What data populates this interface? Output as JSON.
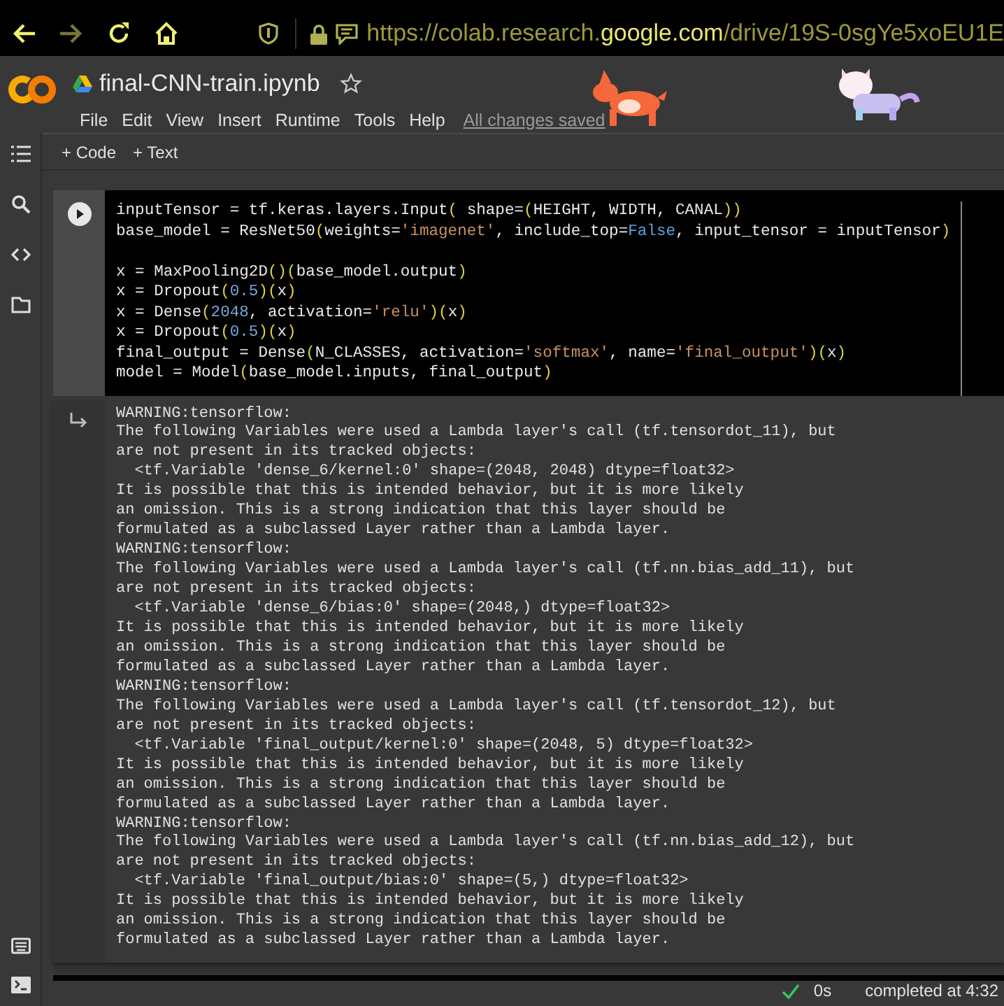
{
  "browser": {
    "nav": [
      {
        "kind": "back",
        "disabled": false
      },
      {
        "kind": "forward",
        "disabled": true
      },
      {
        "kind": "reload",
        "disabled": false
      },
      {
        "kind": "home",
        "disabled": false
      }
    ],
    "url": {
      "prefix": "https://colab.research.",
      "domain": "google.com",
      "path": "/drive/19S-0sgYe5xoEU1E"
    }
  },
  "header": {
    "title": "final-CNN-train.ipynb",
    "starred": false,
    "menu": [
      "File",
      "Edit",
      "View",
      "Insert",
      "Runtime",
      "Tools",
      "Help"
    ],
    "save_status": "All changes saved"
  },
  "toolbar": {
    "buttons": [
      {
        "icon": "+",
        "label": "Code"
      },
      {
        "icon": "+",
        "label": "Text"
      }
    ]
  },
  "sidebar": {
    "top": [
      {
        "kind": "toc"
      },
      {
        "kind": "search"
      },
      {
        "kind": "code"
      },
      {
        "kind": "folder"
      }
    ],
    "bottom": [
      {
        "kind": "palette"
      },
      {
        "kind": "terminal"
      }
    ]
  },
  "cell": {
    "code": [
      {
        "tokens": [
          {
            "text": "inputTensor = tf.keras.layers.Input",
            "kind": "plain"
          },
          {
            "text": "(",
            "kind": "bracket"
          },
          {
            "text": " shape=",
            "kind": "plain"
          },
          {
            "text": "(",
            "kind": "bracket"
          },
          {
            "text": "HEIGHT, WIDTH, CANAL",
            "kind": "plain"
          },
          {
            "text": "))",
            "kind": "bracket"
          }
        ]
      },
      {
        "tokens": [
          {
            "text": "base_model = ResNet50",
            "kind": "plain"
          },
          {
            "text": "(",
            "kind": "bracket"
          },
          {
            "text": "weights=",
            "kind": "plain"
          },
          {
            "text": "'imagenet'",
            "kind": "string"
          },
          {
            "text": ", include_top=",
            "kind": "plain"
          },
          {
            "text": "False",
            "kind": "keyword"
          },
          {
            "text": ", input_tensor = inputTensor",
            "kind": "plain"
          },
          {
            "text": ")",
            "kind": "bracket"
          }
        ]
      },
      {
        "gap_before": true,
        "tokens": [
          {
            "text": "x = MaxPooling2D",
            "kind": "plain"
          },
          {
            "text": "()(",
            "kind": "bracket"
          },
          {
            "text": "base_model.output",
            "kind": "plain"
          },
          {
            "text": ")",
            "kind": "bracket"
          }
        ]
      },
      {
        "tokens": [
          {
            "text": "x = Dropout",
            "kind": "plain"
          },
          {
            "text": "(",
            "kind": "bracket"
          },
          {
            "text": "0.5",
            "kind": "number"
          },
          {
            "text": ")(",
            "kind": "bracket"
          },
          {
            "text": "x",
            "kind": "plain"
          },
          {
            "text": ")",
            "kind": "bracket"
          }
        ]
      },
      {
        "tokens": [
          {
            "text": "x = Dense",
            "kind": "plain"
          },
          {
            "text": "(",
            "kind": "bracket"
          },
          {
            "text": "2048",
            "kind": "number"
          },
          {
            "text": ", activation=",
            "kind": "plain"
          },
          {
            "text": "'relu'",
            "kind": "string"
          },
          {
            "text": ")(",
            "kind": "bracket"
          },
          {
            "text": "x",
            "kind": "plain"
          },
          {
            "text": ")",
            "kind": "bracket"
          }
        ]
      },
      {
        "tokens": [
          {
            "text": "x = Dropout",
            "kind": "plain"
          },
          {
            "text": "(",
            "kind": "bracket"
          },
          {
            "text": "0.5",
            "kind": "number"
          },
          {
            "text": ")(",
            "kind": "bracket"
          },
          {
            "text": "x",
            "kind": "plain"
          },
          {
            "text": ")",
            "kind": "bracket"
          }
        ]
      },
      {
        "tokens": [
          {
            "text": "final_output = Dense",
            "kind": "plain"
          },
          {
            "text": "(",
            "kind": "bracket"
          },
          {
            "text": "N_CLASSES, activation=",
            "kind": "plain"
          },
          {
            "text": "'softmax'",
            "kind": "string"
          },
          {
            "text": ", name=",
            "kind": "plain"
          },
          {
            "text": "'final_output'",
            "kind": "string"
          },
          {
            "text": ")(",
            "kind": "bracket"
          },
          {
            "text": "x",
            "kind": "plain"
          },
          {
            "text": ")",
            "kind": "bracket"
          }
        ]
      },
      {
        "tokens": [
          {
            "text": "model = Model",
            "kind": "plain"
          },
          {
            "text": "(",
            "kind": "bracket"
          },
          {
            "text": "base_model.inputs, final_output",
            "kind": "plain"
          },
          {
            "text": ")",
            "kind": "bracket"
          }
        ]
      }
    ],
    "output": [
      "WARNING:tensorflow:",
      "The following Variables were used a Lambda layer's call (tf.tensordot_11), but",
      "are not present in its tracked objects:",
      "  <tf.Variable 'dense_6/kernel:0' shape=(2048, 2048) dtype=float32>",
      "It is possible that this is intended behavior, but it is more likely",
      "an omission. This is a strong indication that this layer should be",
      "formulated as a subclassed Layer rather than a Lambda layer.",
      "WARNING:tensorflow:",
      "The following Variables were used a Lambda layer's call (tf.nn.bias_add_11), but",
      "are not present in its tracked objects:",
      "  <tf.Variable 'dense_6/bias:0' shape=(2048,) dtype=float32>",
      "It is possible that this is intended behavior, but it is more likely",
      "an omission. This is a strong indication that this layer should be",
      "formulated as a subclassed Layer rather than a Lambda layer.",
      "WARNING:tensorflow:",
      "The following Variables were used a Lambda layer's call (tf.tensordot_12), but",
      "are not present in its tracked objects:",
      "  <tf.Variable 'final_output/kernel:0' shape=(2048, 5) dtype=float32>",
      "It is possible that this is intended behavior, but it is more likely",
      "an omission. This is a strong indication that this layer should be",
      "formulated as a subclassed Layer rather than a Lambda layer.",
      "WARNING:tensorflow:",
      "The following Variables were used a Lambda layer's call (tf.nn.bias_add_12), but",
      "are not present in its tracked objects:",
      "  <tf.Variable 'final_output/bias:0' shape=(5,) dtype=float32>",
      "It is possible that this is intended behavior, but it is more likely",
      "an omission. This is a strong indication that this layer should be",
      "formulated as a subclassed Layer rather than a Lambda layer."
    ]
  },
  "status_bar": {
    "duration": "0s",
    "completed": "completed at 4:32"
  }
}
